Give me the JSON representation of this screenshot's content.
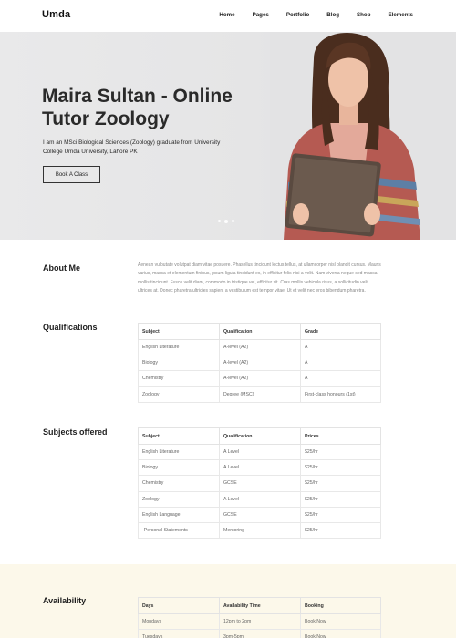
{
  "nav": {
    "logo": "Umda",
    "items": [
      "Home",
      "Pages",
      "Portfolio",
      "Blog",
      "Shop",
      "Elements"
    ]
  },
  "hero": {
    "title": "Maira Sultan - Online Tutor Zoology",
    "description": "I am an MSci Biological Sciences (Zoology) graduate from University College Umda University, Lahore PK",
    "button": "Book A Class"
  },
  "about": {
    "title": "About Me",
    "text": "Aenean vulputate volutpat diam vitae posuere. Phasellus tincidunt lectus tellus, at ullamcorper nisl blandit cursus. Mauris varius, massa et elementum finibus, ipsum ligula tincidunt ex, in efficitur felis nisi a velit. Nam viverra neque sed massa mollis tincidunt. Fusce velit diam, commodo in tristique vel, efficitur sit. Cras mollis vehicula risus, a sollicitudin velit ultrices at. Donec pharetra ultricies sapien, a vestibulum est tempor vitae. Ut et velit nec eros bibendum pharetra."
  },
  "qualifications": {
    "title": "Qualifications",
    "headers": [
      "Subject",
      "Qualification",
      "Grade"
    ],
    "rows": [
      [
        "English Literature",
        "A-level (A2)",
        "A"
      ],
      [
        "Biology",
        "A-level (A2)",
        "A"
      ],
      [
        "Chemistry",
        "A-level (A2)",
        "A"
      ],
      [
        "Zoology",
        "Degree (MSC)",
        "First-class honours (1st)"
      ]
    ]
  },
  "subjects": {
    "title": "Subjects offered",
    "headers": [
      "Subject",
      "Qualification",
      "Prices"
    ],
    "rows": [
      [
        "English Literature",
        "A Level",
        "$25/hr"
      ],
      [
        "Biology",
        "A Level",
        "$25/hr"
      ],
      [
        "Chemistry",
        "GCSE",
        "$25/hr"
      ],
      [
        "Zoology",
        "A Level",
        "$25/hr"
      ],
      [
        "English Language",
        "GCSE",
        "$25/hr"
      ],
      [
        "-Personal Statements-",
        "Mentoring",
        "$25/hr"
      ]
    ]
  },
  "availability": {
    "title": "Availability",
    "headers": [
      "Days",
      "Availability Time",
      "Booking"
    ],
    "rows": [
      [
        "Mondays",
        "12pm to 2pm",
        "Book Now"
      ],
      [
        "Tuesdays",
        "3pm-5pm",
        "Book Now"
      ]
    ]
  },
  "colors": {
    "availability_background": "#fcf8ea",
    "hero_background": "#e6e6e7"
  }
}
